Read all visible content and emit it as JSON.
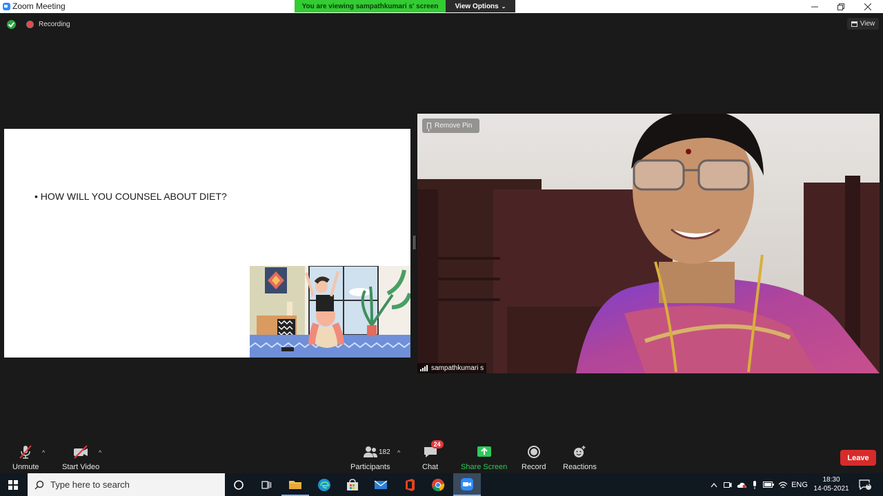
{
  "window": {
    "title": "Zoom Meeting"
  },
  "banner": {
    "message": "You are viewing sampathkumari s' screen",
    "options_label": "View Options"
  },
  "status": {
    "recording_label": "Recording",
    "view_label": "View"
  },
  "slide": {
    "bullet_text": "• HOW WILL YOU COUNSEL ABOUT DIET?"
  },
  "video": {
    "remove_pin_label": "Remove Pin",
    "participant_name": "sampathkumari s"
  },
  "toolbar": {
    "unmute_label": "Unmute",
    "start_video_label": "Start Video",
    "participants_label": "Participants",
    "participants_count": "182",
    "chat_label": "Chat",
    "chat_badge": "24",
    "share_screen_label": "Share Screen",
    "record_label": "Record",
    "reactions_label": "Reactions",
    "leave_label": "Leave"
  },
  "taskbar": {
    "search_placeholder": "Type here to search",
    "language": "ENG",
    "time": "18:30",
    "date": "14-05-2021",
    "notification_count": "2"
  },
  "colors": {
    "share_screen_green": "#2ec95c",
    "banner_green": "#33cc33",
    "leave_red": "#d72b2b",
    "badge_red": "#e0383e"
  }
}
